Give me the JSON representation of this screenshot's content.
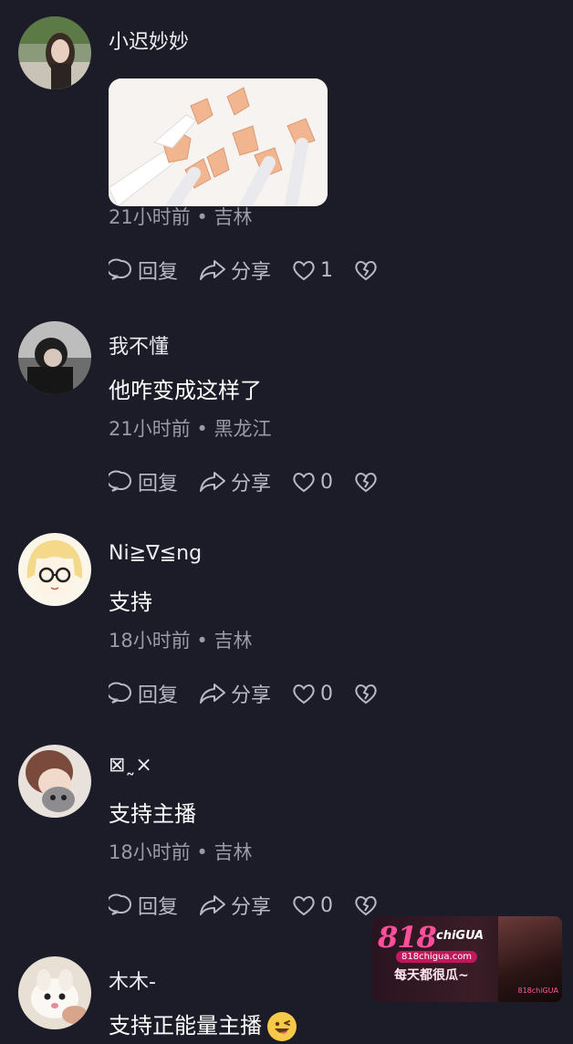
{
  "comments": [
    {
      "username": "小迟妙妙",
      "content": "",
      "has_image": true,
      "meta": "21小时前 • 吉林",
      "reply_label": "回复",
      "share_label": "分享",
      "like_count": "1"
    },
    {
      "username": "我不懂",
      "content": "他咋变成这样了",
      "meta": "21小时前 • 黑龙江",
      "reply_label": "回复",
      "share_label": "分享",
      "like_count": "0"
    },
    {
      "username": "Ni≧∇≦ng",
      "content": "支持",
      "meta": "18小时前 • 吉林",
      "reply_label": "回复",
      "share_label": "分享",
      "like_count": "0"
    },
    {
      "username": "⊠˷×",
      "content": "支持主播",
      "meta": "18小时前 • 吉林",
      "reply_label": "回复",
      "share_label": "分享",
      "like_count": "0"
    },
    {
      "username": "木木-",
      "content": "支持正能量主播"
    }
  ],
  "ad": {
    "logo": "818",
    "logo_sub": "chiGUA",
    "site": "818chigua.com",
    "slogan": "每天都很瓜~",
    "photo_label": "818chiGUA"
  },
  "colors": {
    "background": "#1b1c28",
    "meta_text": "#9a9ba6",
    "action_text": "#b9bac4",
    "ad_accent": "#ff4f9b"
  }
}
